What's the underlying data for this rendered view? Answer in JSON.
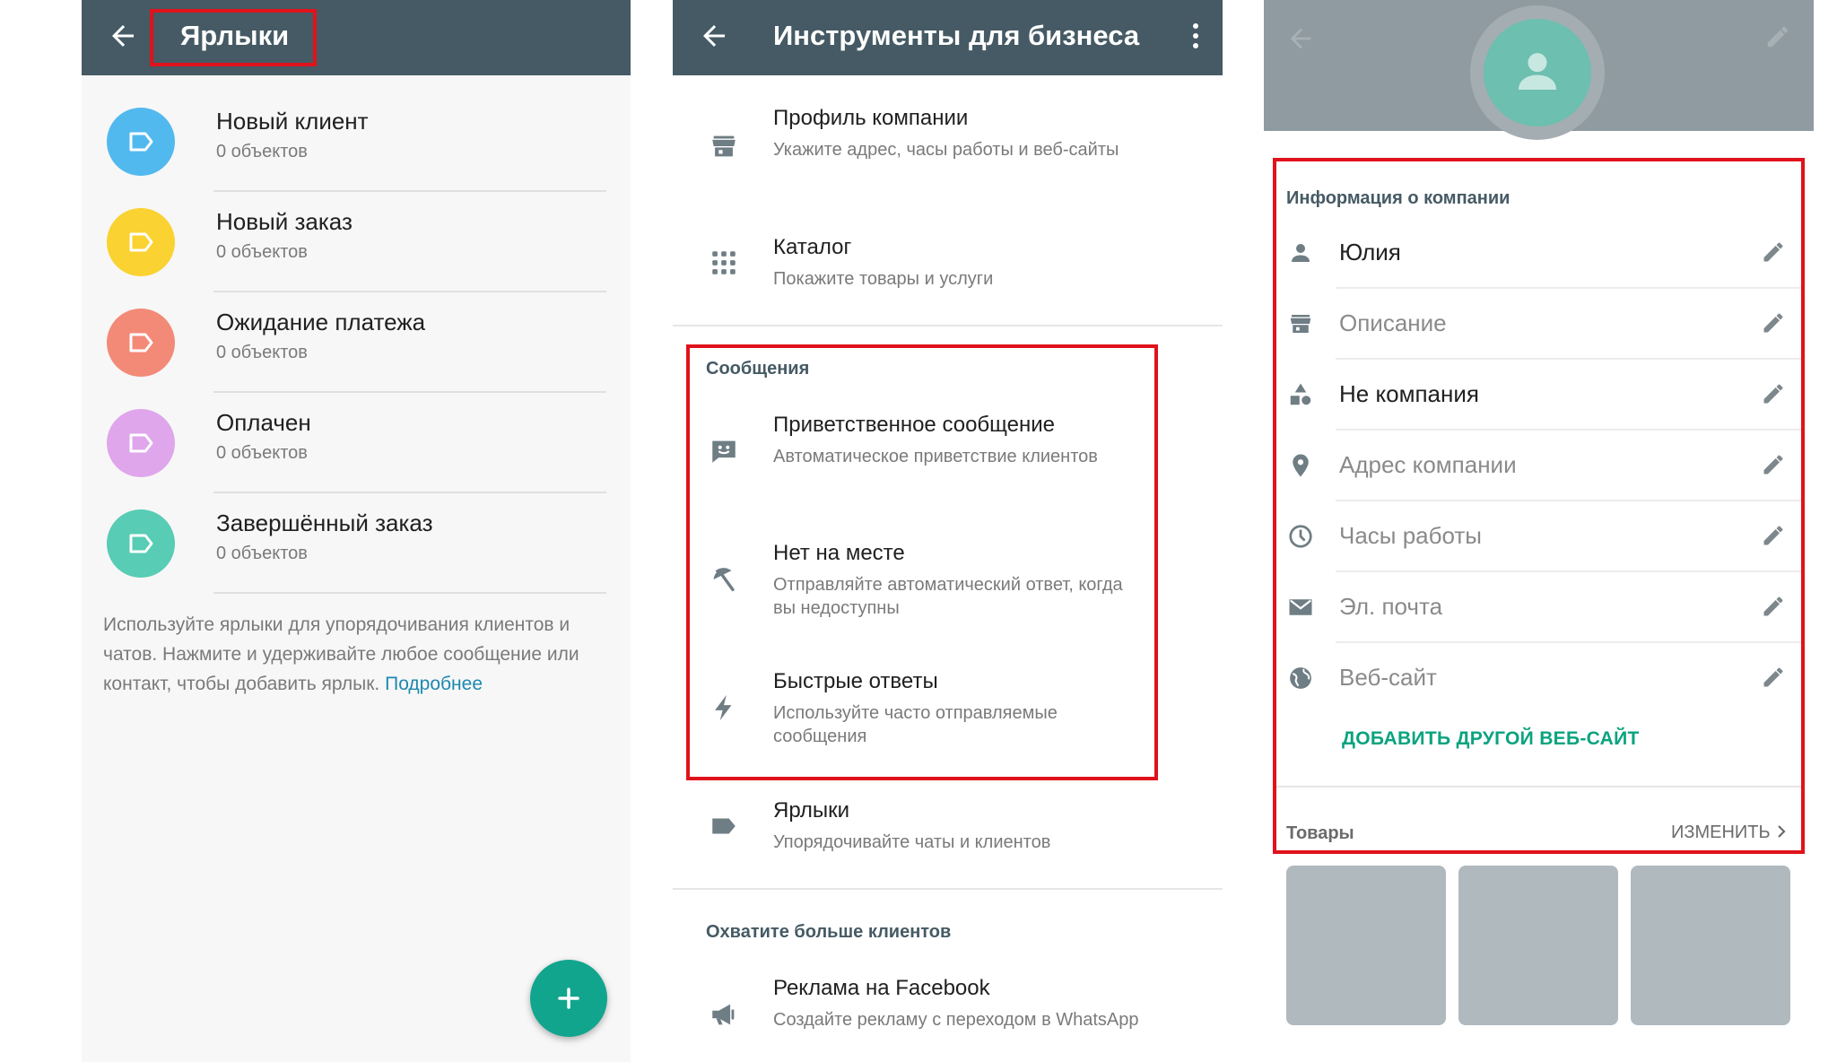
{
  "panel_labels": {
    "title": "Ярлыки",
    "labels": [
      {
        "name": "Новый клиент",
        "count": "0 объектов",
        "color": "#52b9ef"
      },
      {
        "name": "Новый заказ",
        "count": "0 объектов",
        "color": "#fad231"
      },
      {
        "name": "Ожидание платежа",
        "count": "0 объектов",
        "color": "#f38a78"
      },
      {
        "name": "Оплачен",
        "count": "0 объектов",
        "color": "#dfa6ec"
      },
      {
        "name": "Завершённый заказ",
        "count": "0 объектов",
        "color": "#58ccb4"
      }
    ],
    "hint": "Используйте ярлыки для упорядочивания клиентов и чатов. Нажмите и удерживайте любое сообщение или контакт, чтобы добавить ярлык.",
    "hint_link": "Подробнее"
  },
  "panel_tools": {
    "title": "Инструменты для бизнеса",
    "profile": {
      "title": "Профиль компании",
      "subtitle": "Укажите адрес, часы работы и веб-сайты"
    },
    "catalog": {
      "title": "Каталог",
      "subtitle": "Покажите товары и услуги"
    },
    "messages_section": "Сообщения",
    "greeting": {
      "title": "Приветственное сообщение",
      "subtitle": "Автоматическое приветствие клиентов"
    },
    "away": {
      "title": "Нет на месте",
      "subtitle": "Отправляйте автоматический ответ, когда вы недоступны"
    },
    "quick": {
      "title": "Быстрые ответы",
      "subtitle": "Используйте часто отправляемые сообщения"
    },
    "labels": {
      "title": "Ярлыки",
      "subtitle": "Упорядочивайте чаты и клиентов"
    },
    "reach_section": "Охватите больше клиентов",
    "facebook": {
      "title": "Реклама на Facebook",
      "subtitle": "Создайте рекламу с переходом в WhatsApp"
    }
  },
  "panel_profile": {
    "info_header": "Информация о компании",
    "fields": [
      {
        "icon": "person-icon",
        "text": "Юлия",
        "filled": true
      },
      {
        "icon": "store-icon",
        "text": "Описание",
        "filled": false
      },
      {
        "icon": "category-icon",
        "text": "Не компания",
        "filled": true
      },
      {
        "icon": "location-icon",
        "text": "Адрес компании",
        "filled": false
      },
      {
        "icon": "clock-icon",
        "text": "Часы работы",
        "filled": false
      },
      {
        "icon": "mail-icon",
        "text": "Эл. почта",
        "filled": false
      },
      {
        "icon": "globe-icon",
        "text": "Веб-сайт",
        "filled": false
      }
    ],
    "add_website": "ДОБАВИТЬ ДРУГОЙ ВЕБ-САЙТ",
    "goods_header": "Товары",
    "goods_edit": "ИЗМЕНИТЬ"
  },
  "colors": {
    "appbar": "#455a64",
    "accent": "#0aa37f",
    "highlight": "#e0121b",
    "fab": "#12a58e"
  }
}
